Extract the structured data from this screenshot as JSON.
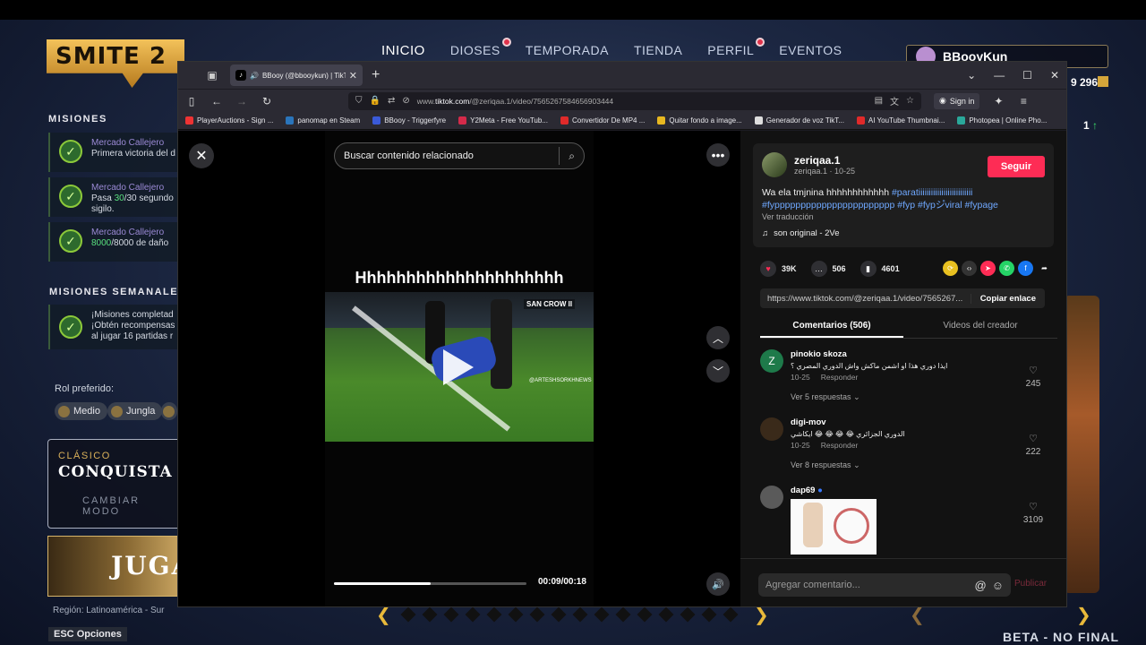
{
  "game": {
    "logo": "SMITE 2",
    "nav": [
      {
        "label": "INICIO",
        "active": true,
        "notif": false
      },
      {
        "label": "DIOSES",
        "active": false,
        "notif": true
      },
      {
        "label": "TEMPORADA",
        "active": false,
        "notif": false
      },
      {
        "label": "TIENDA",
        "active": false,
        "notif": false
      },
      {
        "label": "PERFIL",
        "active": false,
        "notif": true
      },
      {
        "label": "EVENTOS",
        "active": false,
        "notif": false
      }
    ],
    "player_name": "BBooyKun",
    "currency": "9 296",
    "level_indicator": "1",
    "missions_title": "MISIONES",
    "missions": [
      {
        "title": "Mercado Callejero",
        "line1": "Primera victoria del d",
        "line2": ""
      },
      {
        "title": "Mercado Callejero",
        "line1_pre": "Pasa ",
        "line1_hl": "30",
        "line1_post": "/30 segundo",
        "line2": "sigilo."
      },
      {
        "title": "Mercado Callejero",
        "line1_hl": "8000",
        "line1_post": "/8000 de daño"
      }
    ],
    "weekly_title": "MISIONES SEMANALES",
    "weekly": {
      "line1": "¡Misiones completad",
      "line2": "¡Obtén recompensas",
      "line3": "al jugar 16 partidas r"
    },
    "rol_label": "Rol preferido:",
    "roles": [
      "Medio",
      "Jungla"
    ],
    "mode_type": "CLÁSICO",
    "mode_name": "CONQUISTA",
    "change_mode": "CAMBIAR MODO",
    "play_label": "JUGA",
    "region": "Región: Latinoamérica - Sur",
    "esc_label": "ESC",
    "options_label": "Opciones",
    "beta_text": "BETA - NO FINAL"
  },
  "browser": {
    "tab_title": "BBooy (@bbooykun) | TikTok",
    "url_prefix": "www.",
    "url_domain": "tiktok.com",
    "url_path": "/@zeriqaa.1/video/7565267584656903444",
    "signin": "Sign in",
    "bookmarks": [
      {
        "label": "PlayerAuctions - Sign ...",
        "color": "#e33"
      },
      {
        "label": "panomap en Steam",
        "color": "#2a75bb"
      },
      {
        "label": "BBooy - Triggerfyre",
        "color": "#3a5ad8"
      },
      {
        "label": "Y2Meta - Free YouTub...",
        "color": "#d42a4a"
      },
      {
        "label": "Convertidor De MP4 ...",
        "color": "#e02a2a"
      },
      {
        "label": "Quitar fondo a image...",
        "color": "#e8b820"
      },
      {
        "label": "Generador de voz TikT...",
        "color": "#ddd"
      },
      {
        "label": "AI YouTube Thumbnai...",
        "color": "#e02a2a"
      },
      {
        "label": "Photopea | Online Pho...",
        "color": "#2aa89a"
      }
    ]
  },
  "video": {
    "search_placeholder": "Buscar contenido relacionado",
    "caption": "Hhhhhhhhhhhhhhhhhhhhh",
    "watermark": "SAN CROW II",
    "watermark2": "@ARTESHSORKHNEWS",
    "progress": 0.5,
    "time": "00:09/00:18"
  },
  "post": {
    "author": "zeriqaa.1",
    "author_sub": "zeriqaa.1 · 10-25",
    "follow": "Seguir",
    "desc_text": "Wa ela tmjnina hhhhhhhhhhhh ",
    "desc_tags1": "#paratiiiiiiiiiiiiiiiiiiiiiiiiii",
    "desc_tags2": "#fyppppppppppppppppppppppp #fyp #fypシ゚viral #fypage",
    "translate": "Ver traducción",
    "sound": "son original - 2Ve",
    "likes": "39K",
    "comments": "506",
    "saves": "4601",
    "link": "https://www.tiktok.com/@zeriqaa.1/video/7565267...",
    "copy": "Copiar enlace",
    "tab_comments": "Comentarios (506)",
    "tab_videos": "Videos del creador",
    "comment_list": [
      {
        "user": "pinokio skoza",
        "initial": "Z",
        "avatar_color": "#1e7a4a",
        "text": "ايذا دوري هذا او اشمن ماكش واش الدوري المصري ؟",
        "date": "10-25",
        "reply": "Responder",
        "replies": "Ver 5 respuestas",
        "likes": "245"
      },
      {
        "user": "digi-mov",
        "initial": "",
        "avatar_color": "#3a2a1a",
        "text": "الدوري الجزائري 😂 😂 😂 😂 ايكاشي",
        "date": "10-25",
        "reply": "Responder",
        "replies": "Ver 8 respuestas",
        "likes": "222"
      },
      {
        "user": "dap69",
        "initial": "",
        "avatar_color": "#5a5a5a",
        "text": "",
        "date": "",
        "reply": "",
        "replies": "",
        "likes": "3109"
      }
    ],
    "add_comment": "Agregar comentario...",
    "publish": "Publicar"
  }
}
